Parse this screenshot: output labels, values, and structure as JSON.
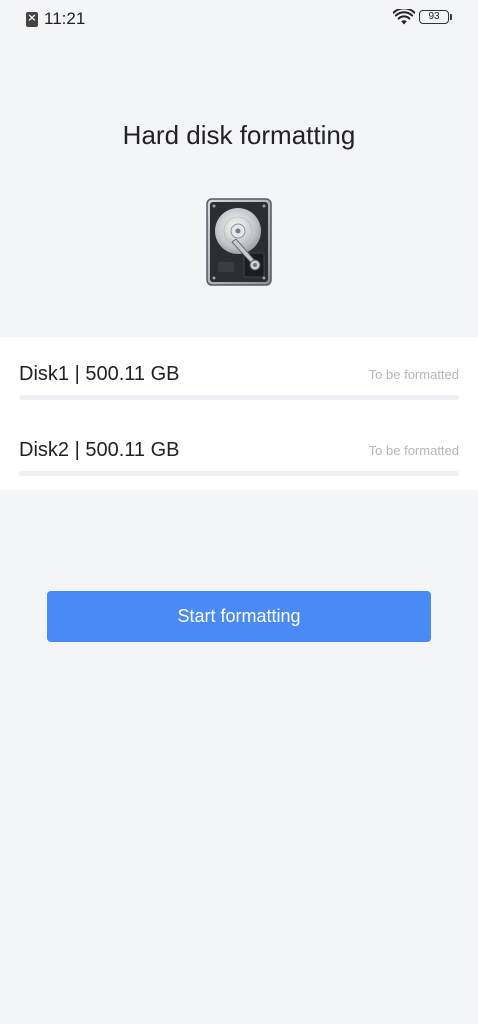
{
  "status_bar": {
    "time": "11:21",
    "battery_level": "93",
    "icons": [
      "sim-off-icon",
      "wifi-icon",
      "battery-icon"
    ]
  },
  "page": {
    "title": "Hard disk formatting",
    "illustration": "hard-disk-icon"
  },
  "disks": [
    {
      "label": "Disk1 | 500.11 GB",
      "status": "To be formatted",
      "progress": 0
    },
    {
      "label": "Disk2 | 500.11 GB",
      "status": "To be formatted",
      "progress": 0
    }
  ],
  "actions": {
    "start_label": "Start formatting"
  },
  "colors": {
    "background": "#f4f5f9",
    "panel": "#ffffff",
    "accent": "#4a8af4",
    "status_text": "#b4b6bb"
  }
}
